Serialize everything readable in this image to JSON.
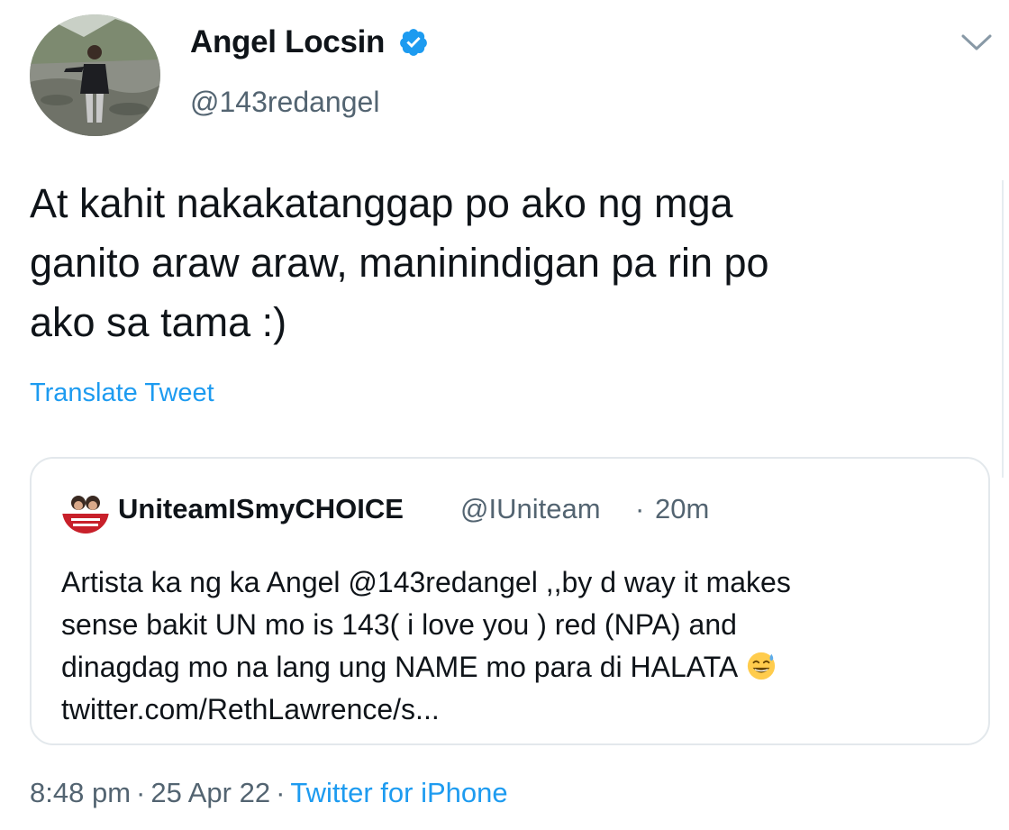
{
  "author": {
    "name": "Angel Locsin",
    "handle": "@143redangel",
    "verified": true
  },
  "tweet": {
    "lines": [
      "At kahit nakakatanggap po ako ng mga",
      "ganito araw araw, maninindigan pa rin po",
      "ako sa tama :)"
    ],
    "translate_label": "Translate Tweet"
  },
  "quote": {
    "name": "UniteamISmyCHOICE",
    "handle": "@IUniteam",
    "separator": "·",
    "time": "20m",
    "lines": [
      "Artista ka ng ka Angel @143redangel ,,by d way it makes",
      "sense bakit UN mo is 143( i love you ) red (NPA) and",
      "dinagdag mo na lang ung NAME mo para di HALATA",
      "twitter.com/RethLawrence/s..."
    ],
    "emoji": "sweat-smile-emoji"
  },
  "footer": {
    "time": "8:48 pm",
    "date": "25 Apr 22",
    "source": "Twitter for iPhone",
    "separator": "·"
  },
  "colors": {
    "text": "#0f1419",
    "secondary": "#536471",
    "link": "#1d9bf0",
    "border": "#e3e8ec"
  },
  "icons": {
    "verified": "verified-badge-icon",
    "menu": "chevron-down-icon"
  }
}
